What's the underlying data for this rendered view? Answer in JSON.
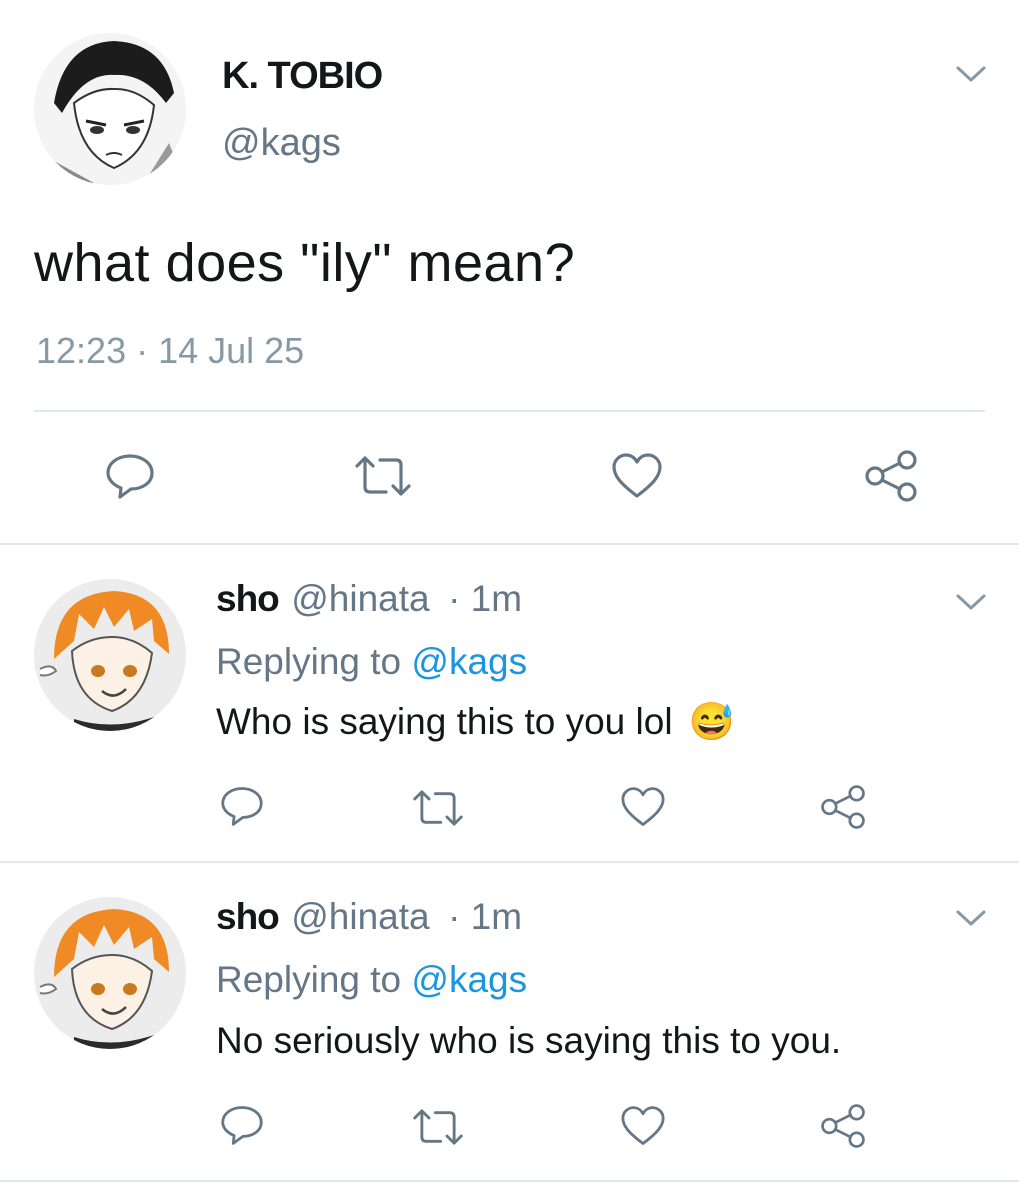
{
  "main_tweet": {
    "display_name": "K. TOBIO",
    "handle": "@kags",
    "text": "what does \"ily\" mean?",
    "timestamp": "12:23 · 14 Jul 25"
  },
  "replies": [
    {
      "display_name": "sho",
      "handle": "@hinata",
      "time": "· 1m",
      "replying_prefix": "Replying to",
      "replying_mention": "@kags",
      "text": "Who is saying this to you lol",
      "emoji": "😅"
    },
    {
      "display_name": "sho",
      "handle": "@hinata",
      "time": "· 1m",
      "replying_prefix": "Replying to",
      "replying_mention": "@kags",
      "text": "No seriously who is saying this to you."
    }
  ],
  "colors": {
    "accent": "#1b95e0",
    "secondary_text": "#657786",
    "divider": "#e1e8ed"
  }
}
